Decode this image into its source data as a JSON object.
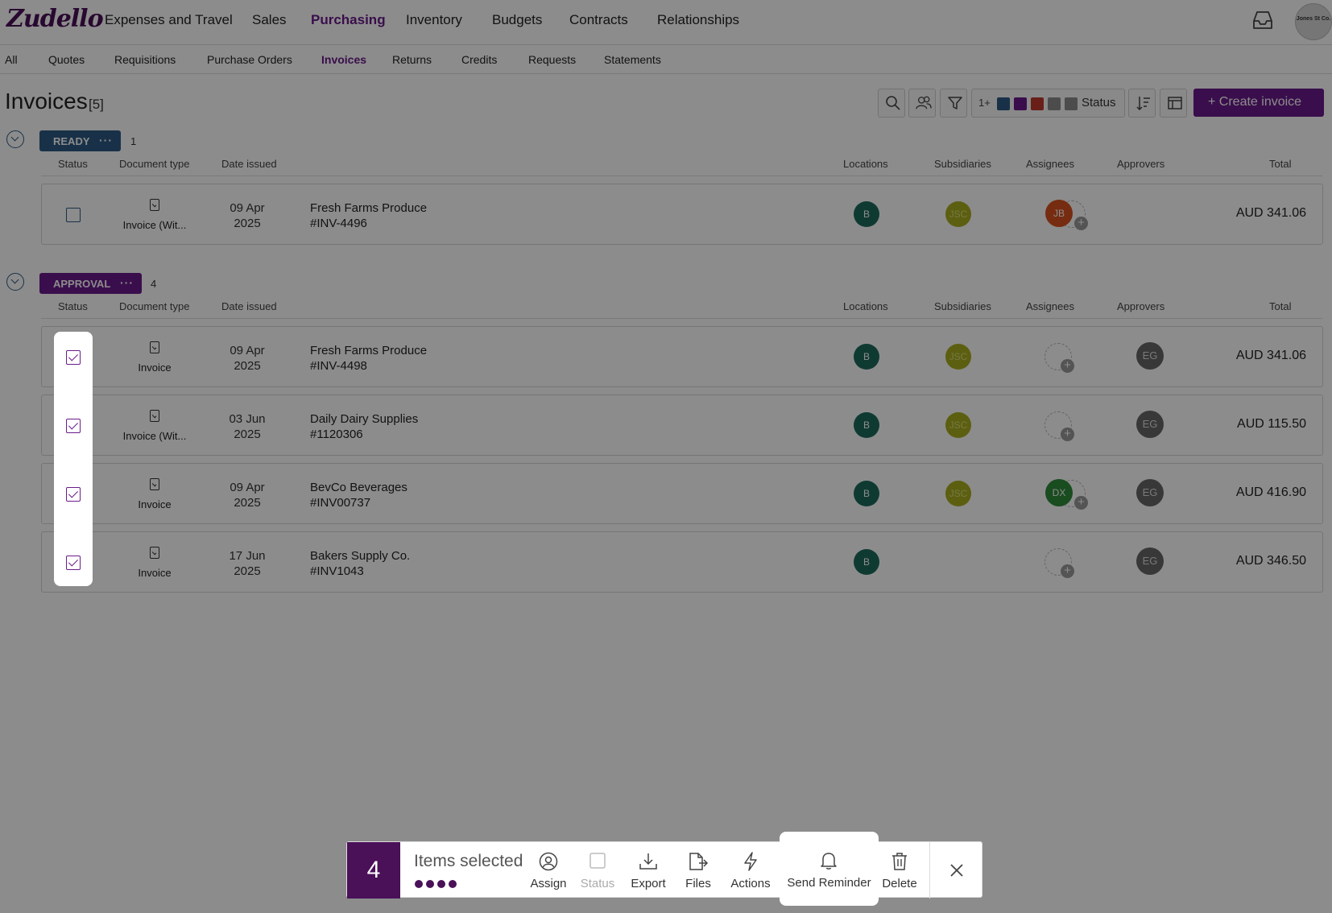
{
  "app": {
    "logo": "Zudello",
    "nav": [
      "Expenses and Travel",
      "Sales",
      "Purchasing",
      "Inventory",
      "Budgets",
      "Contracts",
      "Relationships"
    ],
    "nav_active": "Purchasing",
    "org_avatar": "Jones St Co."
  },
  "subnav": {
    "items": [
      "All",
      "Quotes",
      "Requisitions",
      "Purchase Orders",
      "Invoices",
      "Returns",
      "Credits",
      "Requests",
      "Statements"
    ],
    "active": "Invoices"
  },
  "page": {
    "title": "Invoices",
    "count": "[5]",
    "status_filter_count": "1+",
    "status_filter_label": "Status",
    "status_colors": [
      "#2d5a84",
      "#6a1b8a",
      "#c0392b",
      "#8a8a8a",
      "#8a8a8a"
    ],
    "create_button": "+ Create invoice"
  },
  "columns": {
    "status": "Status",
    "document_type": "Document type",
    "date_issued": "Date issued",
    "locations": "Locations",
    "subsidiaries": "Subsidiaries",
    "assignees": "Assignees",
    "approvers": "Approvers",
    "total": "Total"
  },
  "groups": [
    {
      "label": "READY",
      "color": "#2d5a84",
      "count": "1",
      "rows": [
        {
          "checked": false,
          "doc_type": "Invoice (Wit...",
          "date_line1": "09 Apr",
          "date_line2": "2025",
          "supplier": "Fresh Farms Produce",
          "number": "#INV-4496",
          "location": "B",
          "subsidiary": "JSC",
          "assignee": "JB",
          "assignee_color": "#d8501e",
          "approver": "",
          "total": "AUD 341.06"
        }
      ]
    },
    {
      "label": "APPROVAL",
      "color": "#6a1b8a",
      "count": "4",
      "rows": [
        {
          "checked": true,
          "doc_type": "Invoice",
          "date_line1": "09 Apr",
          "date_line2": "2025",
          "supplier": "Fresh Farms Produce",
          "number": "#INV-4498",
          "location": "B",
          "subsidiary": "JSC",
          "assignee": "",
          "approver": "EG",
          "total": "AUD 341.06"
        },
        {
          "checked": true,
          "doc_type": "Invoice (Wit...",
          "date_line1": "03 Jun",
          "date_line2": "2025",
          "supplier": "Daily Dairy Supplies",
          "number": "#1120306",
          "location": "B",
          "subsidiary": "JSC",
          "assignee": "",
          "approver": "EG",
          "total": "AUD 115.50"
        },
        {
          "checked": true,
          "doc_type": "Invoice",
          "date_line1": "09 Apr",
          "date_line2": "2025",
          "supplier": "BevCo Beverages",
          "number": "#INV00737",
          "location": "B",
          "subsidiary": "JSC",
          "assignee": "DX",
          "assignee_color": "#2e8b3a",
          "approver": "EG",
          "total": "AUD 416.90"
        },
        {
          "checked": true,
          "doc_type": "Invoice",
          "date_line1": "17 Jun",
          "date_line2": "2025",
          "supplier": "Bakers Supply Co.",
          "number": "#INV1043",
          "location": "B",
          "subsidiary": "",
          "assignee": "",
          "approver": "EG",
          "total": "AUD 346.50"
        }
      ]
    }
  ],
  "selection_bar": {
    "count": "4",
    "label": "Items selected",
    "actions": [
      {
        "label": "Assign",
        "icon": "assign-icon",
        "enabled": true
      },
      {
        "label": "Status",
        "icon": "status-icon",
        "enabled": false
      },
      {
        "label": "Export",
        "icon": "export-icon",
        "enabled": true
      },
      {
        "label": "Files",
        "icon": "files-icon",
        "enabled": true
      },
      {
        "label": "Actions",
        "icon": "lightning-icon",
        "enabled": true
      },
      {
        "label": "Send Reminder",
        "icon": "bell-icon",
        "enabled": true
      },
      {
        "label": "Delete",
        "icon": "trash-icon",
        "enabled": true
      }
    ]
  }
}
